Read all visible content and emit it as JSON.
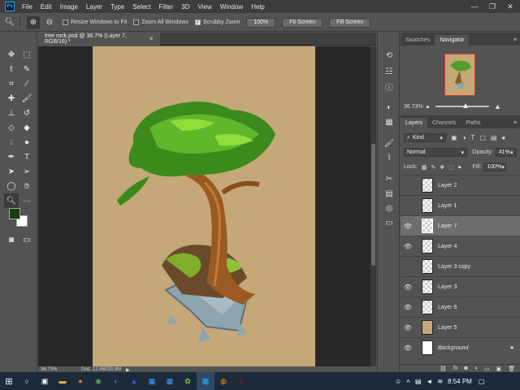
{
  "menubar": {
    "logo": "Ps",
    "items": [
      "File",
      "Edit",
      "Image",
      "Layer",
      "Type",
      "Select",
      "Filter",
      "3D",
      "View",
      "Window",
      "Help"
    ]
  },
  "options": {
    "resize_windows": "Resize Windows to Fit",
    "zoom_all": "Zoom All Windows",
    "scrubby_zoom": "Scrubby Zoom",
    "zoom_value": "100%",
    "fit_screen": "Fit Screen",
    "fill_screen": "Fill Screen"
  },
  "document": {
    "tab_title": "tree rock.psd @ 36.7% (Layer 7, RGB/16) *",
    "zoom": "36.73%",
    "doc_info": "Doc: 12.4M/33.9M"
  },
  "colors": {
    "foreground": "#1a3a10",
    "background": "#ffffff",
    "canvas": "#c4a878"
  },
  "navigator": {
    "tabs": [
      "Swatches",
      "Navigator"
    ],
    "zoom": "36.73%"
  },
  "layers_panel": {
    "tabs": [
      "Layers",
      "Channels",
      "Paths"
    ],
    "filter": "Kind",
    "blend_mode": "Normal",
    "opacity_label": "Opacity:",
    "opacity": "41%",
    "lock_label": "Lock:",
    "fill_label": "Fill:",
    "fill": "100%",
    "layers": [
      {
        "name": "Layer 2",
        "visible": false,
        "selected": false
      },
      {
        "name": "Layer 1",
        "visible": false,
        "selected": false
      },
      {
        "name": "Layer 7",
        "visible": true,
        "selected": true
      },
      {
        "name": "Layer 4",
        "visible": true,
        "selected": false
      },
      {
        "name": "Layer 3 copy",
        "visible": false,
        "selected": false
      },
      {
        "name": "Layer 3",
        "visible": true,
        "selected": false
      },
      {
        "name": "Layer 6",
        "visible": true,
        "selected": false
      },
      {
        "name": "Layer 5",
        "visible": true,
        "selected": false
      },
      {
        "name": "Background",
        "visible": true,
        "selected": false
      }
    ]
  },
  "taskbar": {
    "time": "8:54 PM"
  }
}
